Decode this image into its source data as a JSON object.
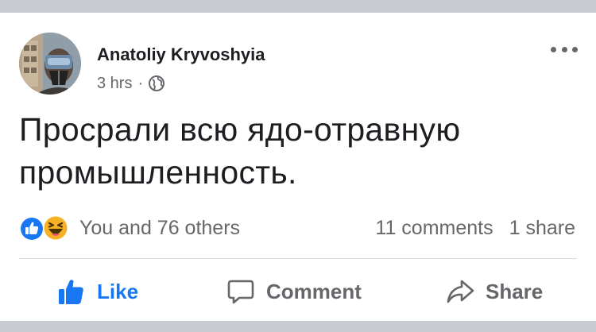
{
  "post": {
    "author": "Anatoliy Kryvoshyia",
    "time": "3 hrs",
    "separator": "·",
    "privacy_icon": "globe-icon",
    "text": "Просрали всю ядо-отравную промышленность."
  },
  "reactions": {
    "types": [
      "like",
      "haha"
    ],
    "summary": "You and 76 others"
  },
  "counts": {
    "comments": "11 comments",
    "shares": "1 share"
  },
  "actions": {
    "like": "Like",
    "comment": "Comment",
    "share": "Share"
  },
  "colors": {
    "accent": "#1877f2",
    "secondary_text": "#65676b",
    "primary_text": "#1c1e21",
    "haha_yellow": "#f7b125",
    "separator_bar": "#c9ccd1"
  }
}
